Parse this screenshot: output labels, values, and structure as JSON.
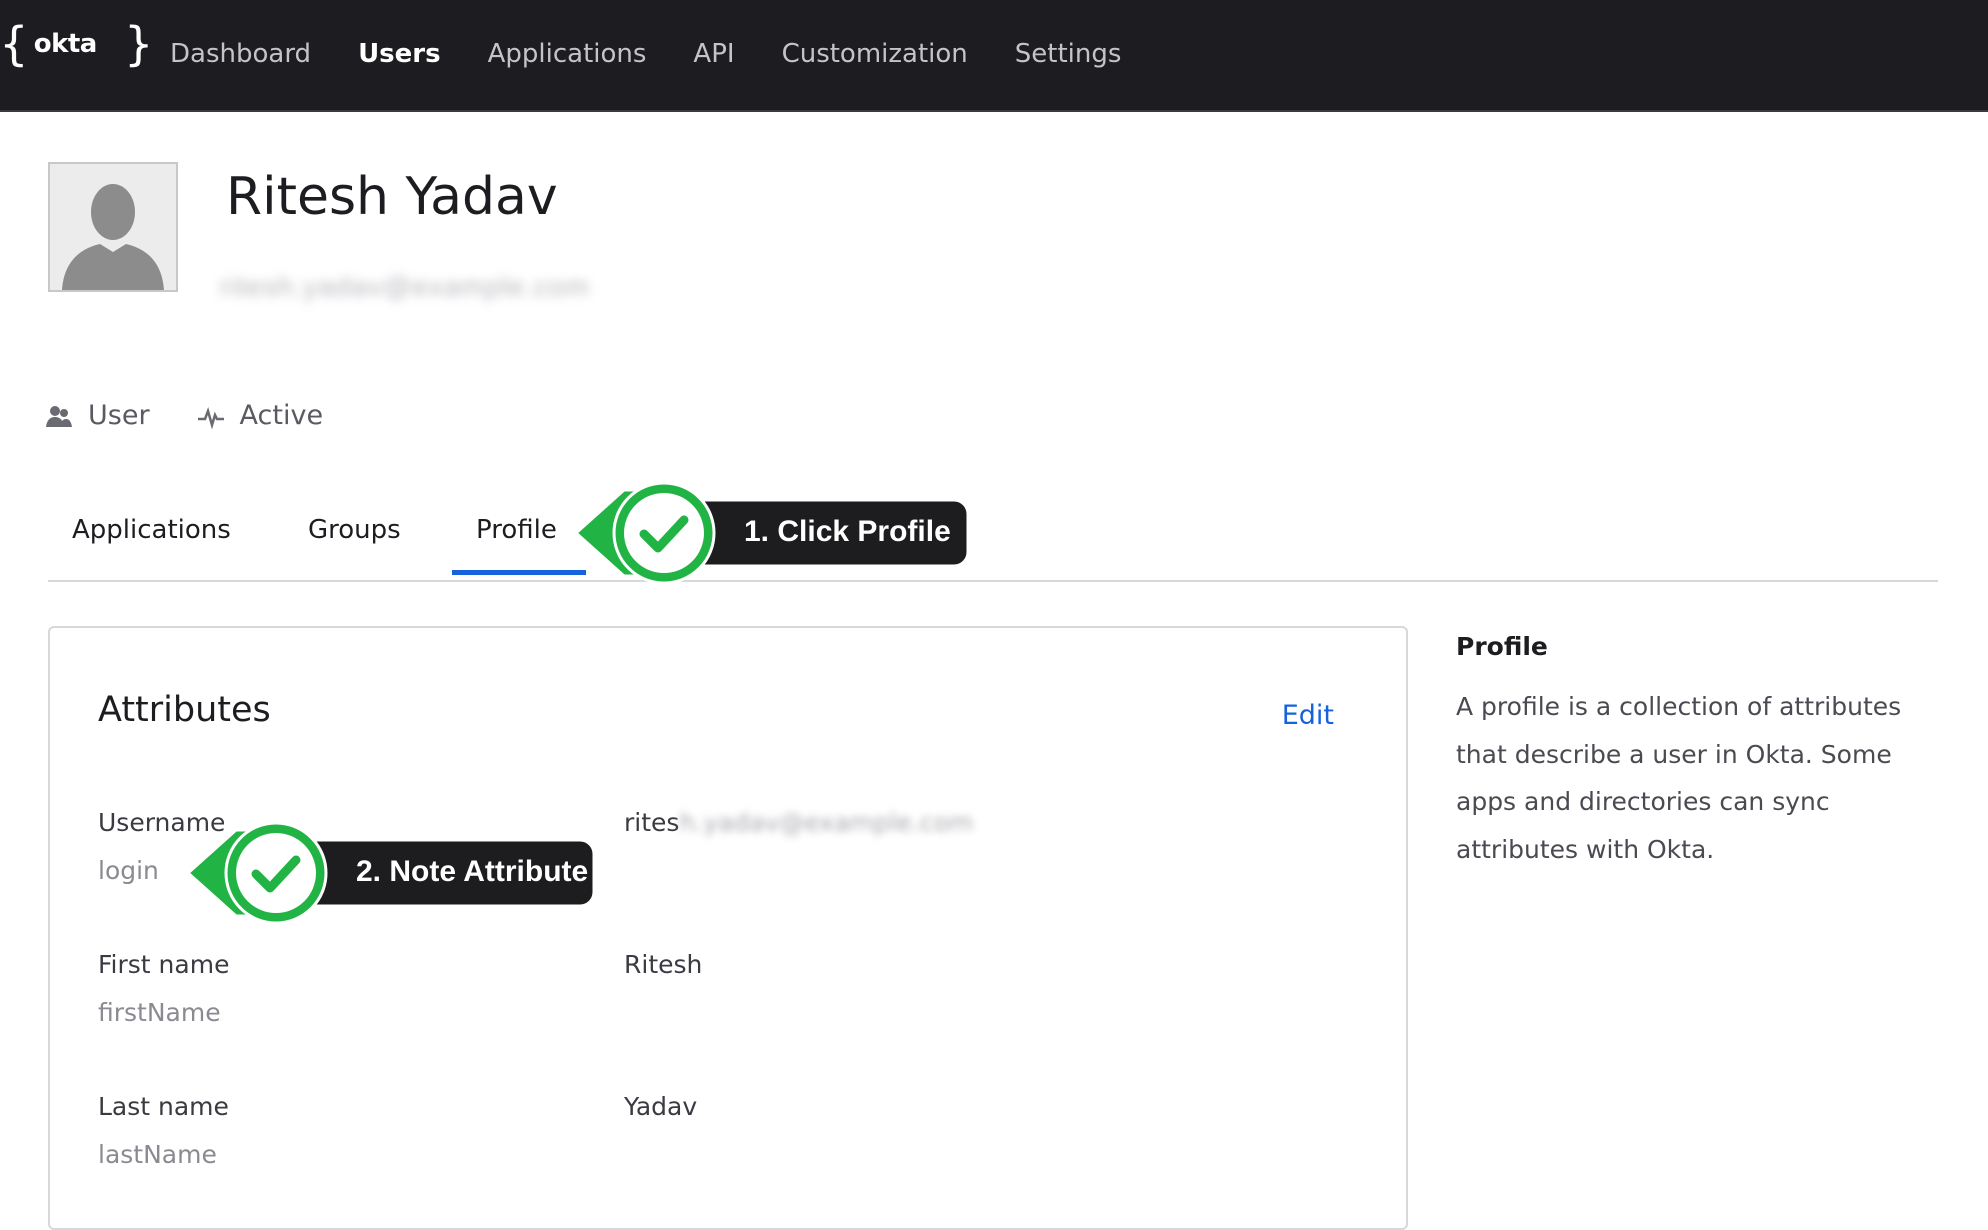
{
  "app": {
    "brand": "okta"
  },
  "nav": {
    "items": [
      "Dashboard",
      "Users",
      "Applications",
      "API",
      "Customization",
      "Settings"
    ],
    "active": "Users"
  },
  "user": {
    "name": "Ritesh Yadav",
    "email_redacted": "ritesh.yadav@example.com",
    "type": "User",
    "status": "Active"
  },
  "tabs": {
    "items": [
      "Applications",
      "Groups",
      "Profile"
    ],
    "active": "Profile"
  },
  "attributes": {
    "title": "Attributes",
    "edit_label": "Edit",
    "rows": [
      {
        "label": "Username",
        "key": "login",
        "value_prefix": "rites",
        "value_redacted": "h.yadav@example.com"
      },
      {
        "label": "First name",
        "key": "firstName",
        "value": "Ritesh"
      },
      {
        "label": "Last name",
        "key": "lastName",
        "value": "Yadav"
      }
    ]
  },
  "side": {
    "title": "Profile",
    "body": "A profile is a collection of attributes that describe a user in Okta. Some apps and directories can sync attributes with Okta."
  },
  "callouts": [
    {
      "label": "1. Click Profile"
    },
    {
      "label": "2. Note Attribute"
    }
  ],
  "colors": {
    "nav_bg": "#1d1d21",
    "accent": "#1662dd",
    "callout_green": "#22b345",
    "callout_dark": "#1d1d1f"
  }
}
